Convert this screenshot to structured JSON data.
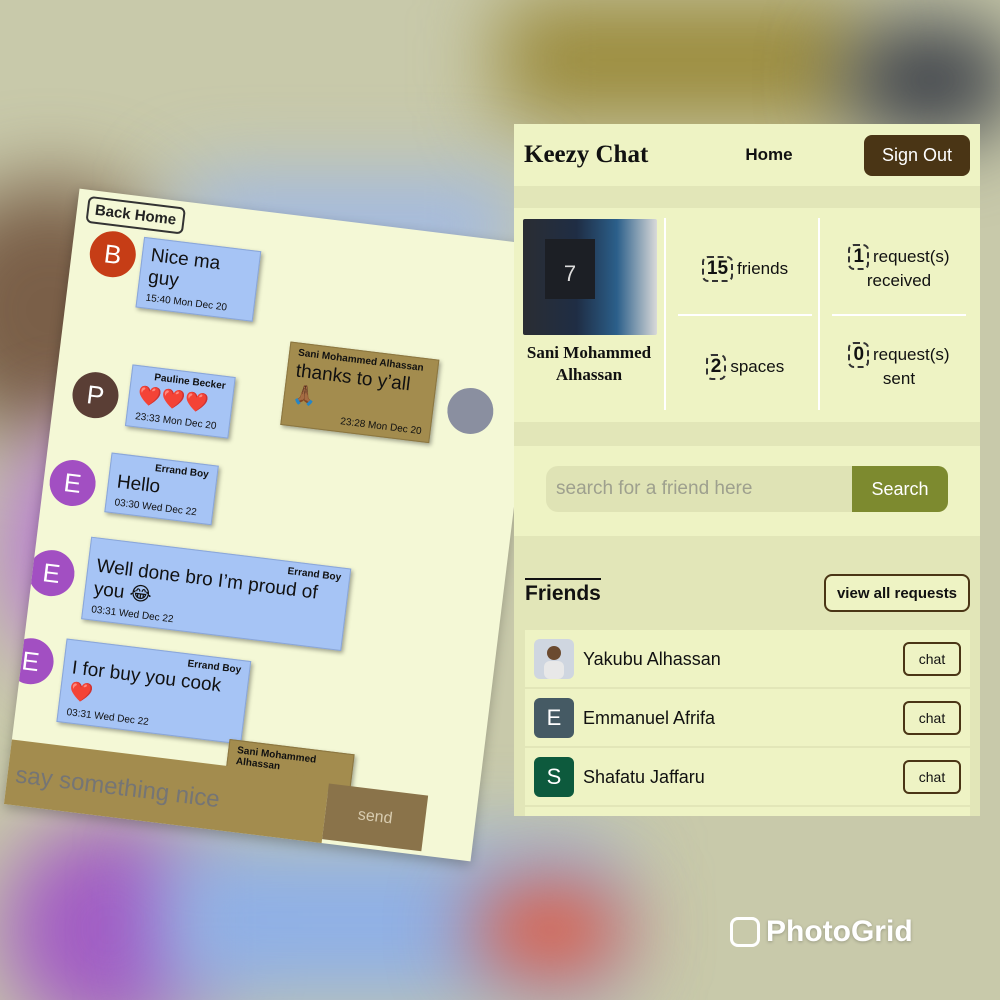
{
  "chat": {
    "back_home": "Back Home",
    "messages": [
      {
        "avatar_letter": "B",
        "avatar_color": "#c63d16",
        "sender": "",
        "text": "Nice ma guy",
        "time": "15:40 Mon Dec 20"
      },
      {
        "avatar_letter": "",
        "avatar_color": "#8a8fa0",
        "sender": "Sani Mohammed Alhassan",
        "text": "thanks to y’all🙏🏾",
        "time": "23:28 Mon Dec 20"
      },
      {
        "avatar_letter": "P",
        "avatar_color": "#5a3e35",
        "sender": "Pauline Becker",
        "text": "❤️❤️❤️",
        "time": "23:33 Mon Dec 20"
      },
      {
        "avatar_letter": "E",
        "avatar_color": "#a24fc2",
        "sender": "Errand Boy",
        "text": "Hello",
        "time": "03:30 Wed Dec 22"
      },
      {
        "avatar_letter": "E",
        "avatar_color": "#a24fc2",
        "sender": "Errand Boy",
        "text": "Well done bro I’m proud of you 😂",
        "time": "03:31 Wed Dec 22"
      },
      {
        "avatar_letter": "E",
        "avatar_color": "#a24fc2",
        "sender": "Errand Boy",
        "text": "I for buy you cook ❤️",
        "time": "03:31 Wed Dec 22"
      },
      {
        "avatar_letter": "",
        "avatar_color": "#8a8fa0",
        "sender": "Sani Mohammed Alhassan",
        "text": "",
        "time": ""
      }
    ],
    "input_placeholder": "say something nice",
    "send_label": "send"
  },
  "app": {
    "title": "Keezy Chat",
    "nav_home": "Home",
    "sign_out": "Sign Out",
    "profile": {
      "name": "Sani Mohammed Alhassan",
      "jersey_number": "7"
    },
    "stats": {
      "friends_count": "15",
      "friends_label": "friends",
      "received_count": "1",
      "received_label_1": "request(s)",
      "received_label_2": "received",
      "spaces_count": "2",
      "spaces_label": "spaces",
      "sent_count": "0",
      "sent_label_1": "request(s)",
      "sent_label_2": "sent"
    },
    "search": {
      "placeholder": "search for a friend here",
      "button": "Search"
    },
    "friends": {
      "title": "Friends",
      "view_all_requests": "view all requests",
      "list": [
        {
          "name": "Yakubu Alhassan",
          "avatar_letter": "",
          "avatar_color": "#cfd6e0",
          "chat_label": "chat"
        },
        {
          "name": "Emmanuel Afrifa",
          "avatar_letter": "E",
          "avatar_color": "#455a64",
          "chat_label": "chat"
        },
        {
          "name": "Shafatu Jaffaru",
          "avatar_letter": "S",
          "avatar_color": "#0d5a3d",
          "chat_label": "chat"
        }
      ]
    }
  },
  "watermark": "PhotoGrid",
  "colors": {
    "header_bg": "#eef3c4",
    "sign_out_bg": "#4a3515",
    "search_btn_bg": "#7d8a2f",
    "bubble_blue": "#a6c4f5",
    "bubble_mine": "#a38c4e"
  }
}
